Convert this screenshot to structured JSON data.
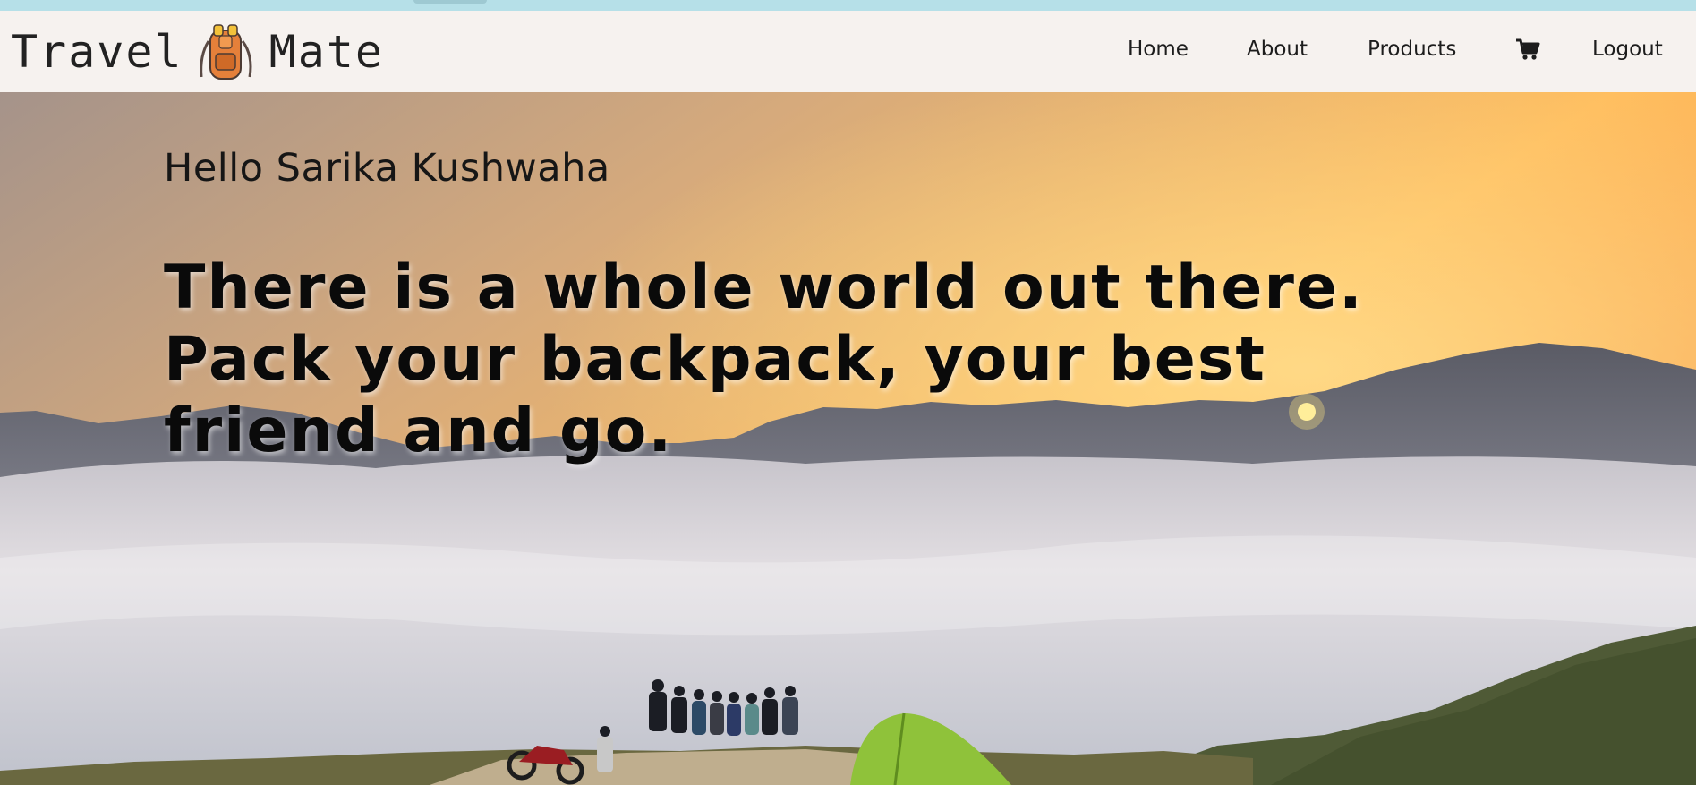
{
  "brand": {
    "left_word": "Travel",
    "right_word": "Mate",
    "logo_icon": "backpack-icon"
  },
  "nav": {
    "home": "Home",
    "about": "About",
    "products": "Products",
    "cart_icon": "shopping-cart-icon",
    "logout": "Logout"
  },
  "hero": {
    "greeting": "Hello Sarika Kushwaha",
    "tagline": "There is a whole world out there. Pack your backpack, your best friend and go."
  },
  "colors": {
    "navbar_bg": "#f6f2ef",
    "sky_top": "#b89c88",
    "sky_glow": "#ffbe5a",
    "tent": "#8fc23a"
  }
}
